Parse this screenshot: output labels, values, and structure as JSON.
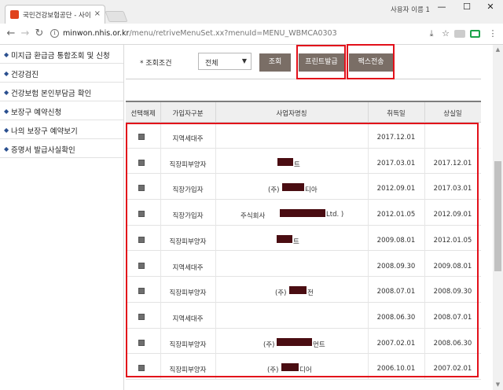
{
  "browser": {
    "tab_title": "국민건강보험공단 - 사이",
    "tab_close": "×",
    "profile_name": "사용자 이름 1",
    "window_controls": {
      "minimize": "—",
      "maximize": "☐",
      "close": "✕"
    },
    "nav": {
      "back": "←",
      "forward": "→",
      "reload": "↻"
    },
    "url_host": "minwon.nhis.or.kr",
    "url_path": "/menu/retriveMenuSet.xx?menuId=MENU_WBMCA0303",
    "toolbar_icons": [
      "download-icon",
      "star-icon",
      "extension-icon",
      "green-extension-icon",
      "menu-icon"
    ]
  },
  "sidebar": {
    "items": [
      {
        "label": "미지급 환급금 통합조회 및 신청"
      },
      {
        "label": "건강검진"
      },
      {
        "label": "건강보험 본인부담금 확인"
      },
      {
        "label": "보장구 예약신청"
      },
      {
        "label": "나의 보장구 예약보기"
      },
      {
        "label": "증명서 발급사실확인"
      }
    ]
  },
  "search": {
    "label": "* 조회조건",
    "select_value": "전체",
    "buttons": {
      "query": "조회",
      "print": "프린트발급",
      "fax": "팩스전송"
    }
  },
  "table": {
    "headers": [
      "선택해제",
      "가입자구분",
      "사업자명칭",
      "취득일",
      "상실일"
    ],
    "rows": [
      {
        "type": "지역세대주",
        "name_prefix": "",
        "name_suffix": "",
        "acquired": "2017.12.01",
        "lost": ""
      },
      {
        "type": "직장피부양자",
        "name_prefix": "",
        "name_suffix": "트",
        "acquired": "2017.03.01",
        "lost": "2017.12.01"
      },
      {
        "type": "직장가입자",
        "name_prefix": "(주)",
        "name_suffix": "티아",
        "acquired": "2012.09.01",
        "lost": "2017.03.01"
      },
      {
        "type": "직장가입자",
        "name_prefix": "주식회사",
        "name_suffix": "Ltd. )",
        "acquired": "2012.01.05",
        "lost": "2012.09.01"
      },
      {
        "type": "직장피부양자",
        "name_prefix": "",
        "name_suffix": "트",
        "acquired": "2009.08.01",
        "lost": "2012.01.05"
      },
      {
        "type": "지역세대주",
        "name_prefix": "",
        "name_suffix": "",
        "acquired": "2008.09.30",
        "lost": "2009.08.01"
      },
      {
        "type": "직장피부양자",
        "name_prefix": "(주)",
        "name_suffix": "전",
        "acquired": "2008.07.01",
        "lost": "2008.09.30"
      },
      {
        "type": "지역세대주",
        "name_prefix": "",
        "name_suffix": "",
        "acquired": "2008.06.30",
        "lost": "2008.07.01"
      },
      {
        "type": "직장피부양자",
        "name_prefix": "(주)",
        "name_suffix": "먼트",
        "acquired": "2007.02.01",
        "lost": "2008.06.30"
      },
      {
        "type": "직장피부양자",
        "name_prefix": "(주)",
        "name_suffix": "디어",
        "acquired": "2006.10.01",
        "lost": "2007.02.01"
      }
    ]
  },
  "colors": {
    "button_bg": "#7a6e66",
    "highlight_border": "#e2101a",
    "redaction": "#4a0d12",
    "bullet": "#2a4f8f"
  }
}
